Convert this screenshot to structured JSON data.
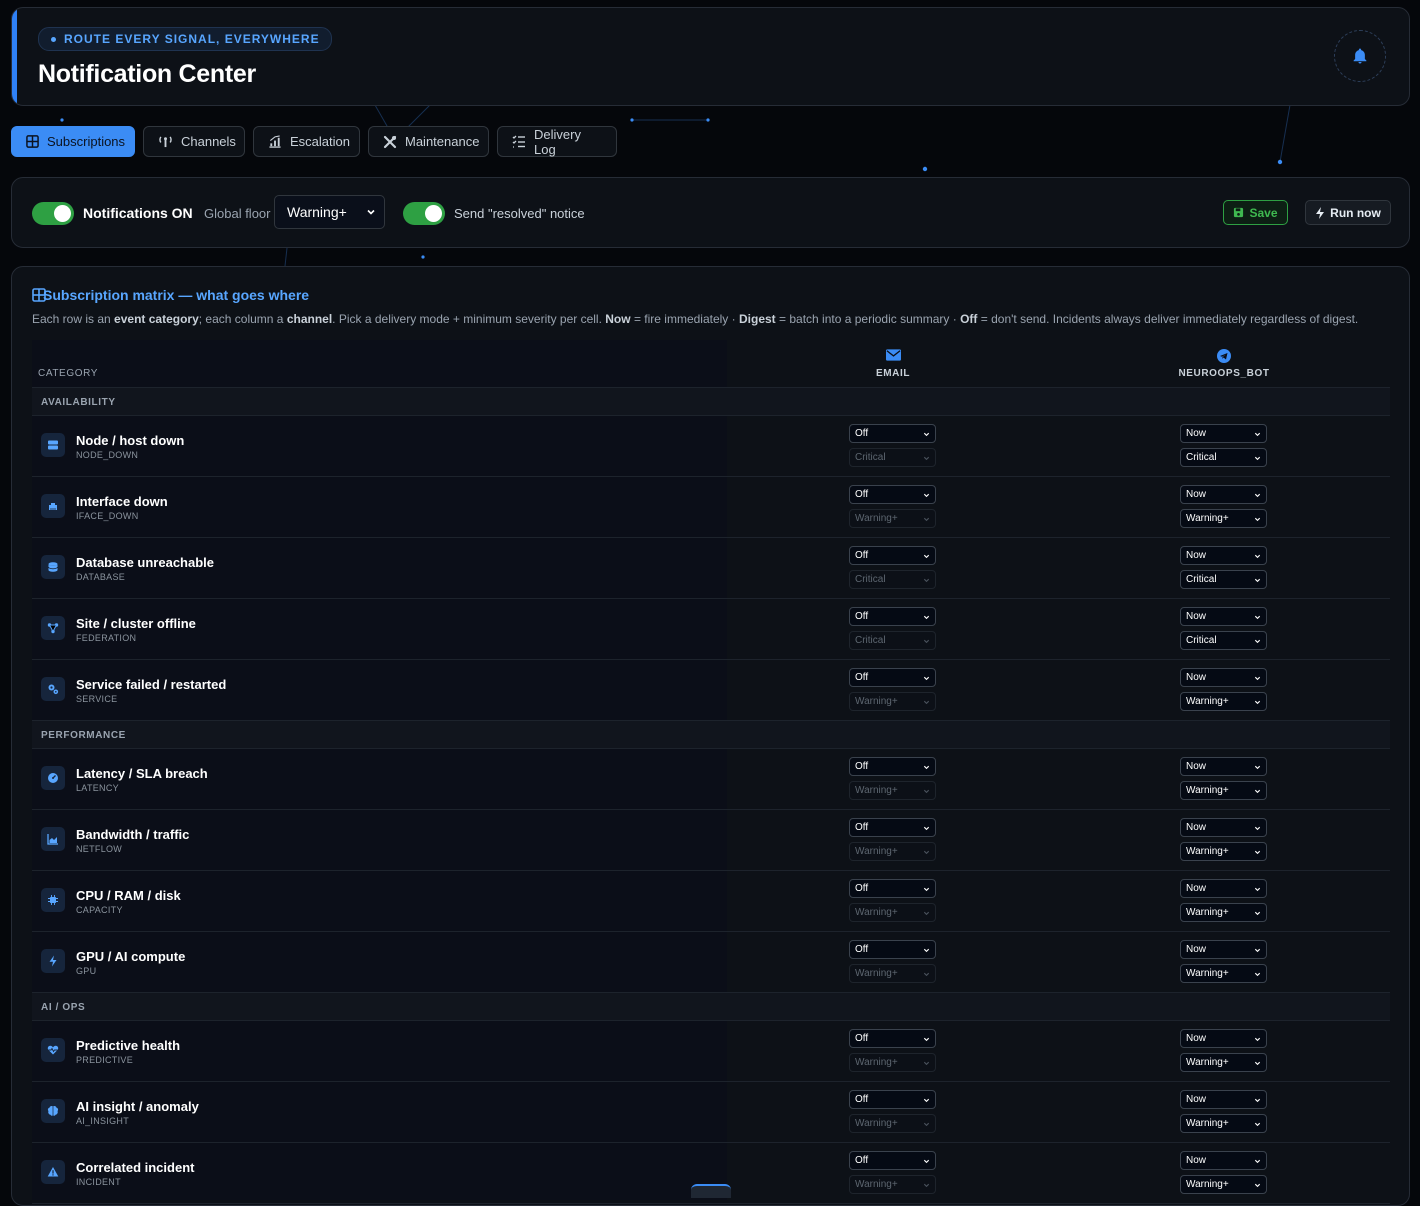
{
  "header": {
    "tagline": "ROUTE EVERY SIGNAL, EVERYWHERE",
    "title": "Notification Center",
    "bell_icon": "bell-icon"
  },
  "tabs": [
    {
      "label": "Subscriptions",
      "icon": "grid-icon",
      "active": true
    },
    {
      "label": "Channels",
      "icon": "broadcast-tower-icon",
      "active": false
    },
    {
      "label": "Escalation",
      "icon": "stairs-chart-icon",
      "active": false
    },
    {
      "label": "Maintenance",
      "icon": "tools-icon",
      "active": false
    },
    {
      "label": "Delivery Log",
      "icon": "list-check-icon",
      "active": false
    }
  ],
  "controls": {
    "notifications_label": "Notifications ON",
    "global_floor_label": "Global floor",
    "global_floor_value": "Warning+",
    "resolved_label": "Send \"resolved\" notice",
    "save_label": "Save",
    "run_label": "Run now"
  },
  "matrix": {
    "title": "Subscription matrix — what goes where",
    "desc_1": "Each row is an ",
    "desc_2": "event category",
    "desc_3": "; each column a ",
    "desc_4": "channel",
    "desc_5": ". Pick a delivery mode + minimum severity per cell. ",
    "desc_6": "Now",
    "desc_7": " = fire immediately · ",
    "desc_8": "Digest",
    "desc_9": " = batch into a periodic summary · ",
    "desc_10": "Off",
    "desc_11": " = don't send. Incidents always deliver immediately regardless of digest.",
    "category_header": "CATEGORY",
    "channels": [
      {
        "name": "EMAIL",
        "icon": "envelope-icon"
      },
      {
        "name": "NEUROOPS_BOT",
        "icon": "telegram-icon"
      }
    ]
  },
  "groups": [
    {
      "name": "AVAILABILITY",
      "rows": [
        {
          "name": "Node / host down",
          "code": "NODE_DOWN",
          "icon": "server-icon",
          "email": [
            "Off",
            "Critical"
          ],
          "bot": [
            "Now",
            "Critical"
          ]
        },
        {
          "name": "Interface down",
          "code": "IFACE_DOWN",
          "icon": "ethernet-icon",
          "email": [
            "Off",
            "Warning+"
          ],
          "bot": [
            "Now",
            "Warning+"
          ]
        },
        {
          "name": "Database unreachable",
          "code": "DATABASE",
          "icon": "database-icon",
          "email": [
            "Off",
            "Critical"
          ],
          "bot": [
            "Now",
            "Critical"
          ]
        },
        {
          "name": "Site / cluster offline",
          "code": "FEDERATION",
          "icon": "network-icon",
          "email": [
            "Off",
            "Critical"
          ],
          "bot": [
            "Now",
            "Critical"
          ]
        },
        {
          "name": "Service failed / restarted",
          "code": "SERVICE",
          "icon": "gears-icon",
          "email": [
            "Off",
            "Warning+"
          ],
          "bot": [
            "Now",
            "Warning+"
          ]
        }
      ]
    },
    {
      "name": "PERFORMANCE",
      "rows": [
        {
          "name": "Latency / SLA breach",
          "code": "LATENCY",
          "icon": "gauge-icon",
          "email": [
            "Off",
            "Warning+"
          ],
          "bot": [
            "Now",
            "Warning+"
          ]
        },
        {
          "name": "Bandwidth / traffic",
          "code": "NETFLOW",
          "icon": "area-chart-icon",
          "email": [
            "Off",
            "Warning+"
          ],
          "bot": [
            "Now",
            "Warning+"
          ]
        },
        {
          "name": "CPU / RAM / disk",
          "code": "CAPACITY",
          "icon": "microchip-icon",
          "email": [
            "Off",
            "Warning+"
          ],
          "bot": [
            "Now",
            "Warning+"
          ]
        },
        {
          "name": "GPU / AI compute",
          "code": "GPU",
          "icon": "bolt-icon",
          "email": [
            "Off",
            "Warning+"
          ],
          "bot": [
            "Now",
            "Warning+"
          ]
        }
      ]
    },
    {
      "name": "AI / OPS",
      "rows": [
        {
          "name": "Predictive health",
          "code": "PREDICTIVE",
          "icon": "heart-pulse-icon",
          "email": [
            "Off",
            "Warning+"
          ],
          "bot": [
            "Now",
            "Warning+"
          ]
        },
        {
          "name": "AI insight / anomaly",
          "code": "AI_INSIGHT",
          "icon": "brain-icon",
          "email": [
            "Off",
            "Warning+"
          ],
          "bot": [
            "Now",
            "Warning+"
          ]
        },
        {
          "name": "Correlated incident",
          "code": "INCIDENT",
          "icon": "warning-triangle-icon",
          "email": [
            "Off",
            "Warning+"
          ],
          "bot": [
            "Now",
            "Warning+"
          ]
        }
      ]
    }
  ],
  "colors": {
    "accent": "#3b8cf5",
    "success": "#2ea043",
    "background": "#05070b",
    "card": "#0d1117"
  }
}
